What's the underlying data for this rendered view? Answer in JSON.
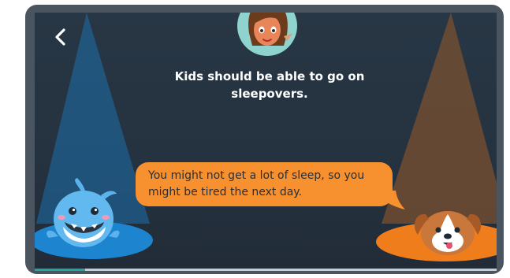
{
  "colors": {
    "background": "#27343f",
    "speech_bubble": "#f7902e",
    "left_spotlight": "#1e7fc4",
    "right_spotlight": "#f07d1c",
    "progress": "#1fa8a0"
  },
  "back_button": {
    "icon": "chevron-left-icon"
  },
  "prompt": {
    "statement": "Kids should be able to go on sleepovers."
  },
  "dialogue": {
    "message": "You might not get a lot of sleep, so you might be tired the next day."
  },
  "characters": {
    "top": "girl-avatar",
    "left": "blue-whale-character",
    "right": "puppy-character"
  },
  "progress": {
    "fraction": 0.11
  }
}
